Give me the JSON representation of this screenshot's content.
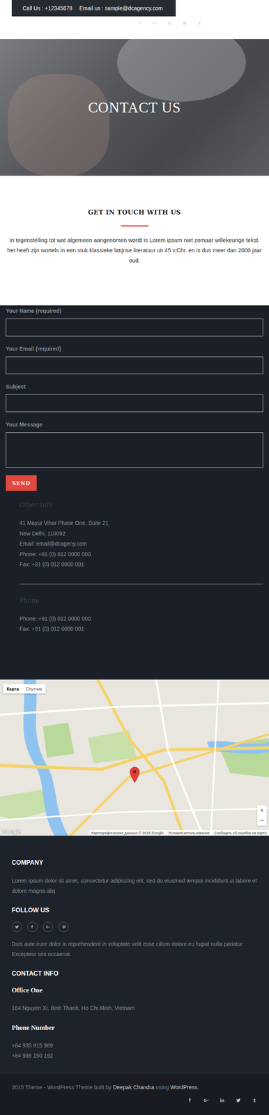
{
  "topbar": {
    "call": "Call Us : +12345678",
    "email": "Email us : sample@dcagency.com"
  },
  "hero": {
    "title": "CONTACT US"
  },
  "intro": {
    "heading": "GET IN TOUCH WITH US",
    "text": "In tegenstelling tot wat algemeen aangenomen wordt is Lorem ipsum niet zomaar willekeurige tekst. het heeft zijn wortels in een stuk klassieke latijnse literatuur uit 45 v.Chr. en is dus meer dan 2000 jaar oud."
  },
  "form": {
    "fields": [
      {
        "label": "Your Name (required)",
        "kind": "input"
      },
      {
        "label": "Your Email (required)",
        "kind": "input"
      },
      {
        "label": "Subject",
        "kind": "input"
      },
      {
        "label": "Your Message",
        "kind": "textarea"
      }
    ],
    "button": "SEND"
  },
  "other_info": {
    "heading": "Other Info",
    "lines": [
      "41 Mayur Vihar Phase One, Suite 21",
      "New Delhi, 110092",
      "Email: email@dcageny.com",
      "Phone: +91 (0) 012 0000 000",
      "Fax: +91 (0) 012 0000 001"
    ]
  },
  "phone": {
    "heading": "Phone",
    "lines": [
      "Phone: +91 (0) 012 0000 000",
      "Fax: +91 (0) 012 0000 001"
    ]
  },
  "map": {
    "tabs": [
      {
        "label": "Карта",
        "selected": true
      },
      {
        "label": "Спутник",
        "selected": false
      }
    ],
    "zoom": [
      "+",
      "−"
    ],
    "logo": "Google",
    "attribution": [
      "Картографические данные © 2016 Google",
      "Условия использования",
      "Сообщить об ошибке на карте"
    ]
  },
  "footer": {
    "company": {
      "heading": "COMPANY",
      "text": "Lorem ipsum dolor sit amet, consectetur adipiscing elit, sed do eiusmod tempor incididunt ut labore et dolore magna aliq"
    },
    "follow": {
      "heading": "FOLLOW US",
      "text": "Duis aute irure dolor in reprehenderit in voluptate velit esse cillum dolore eu fugiat nulla pariatur. Excepteur sint occaecat."
    },
    "contact": {
      "heading": "CONTACT INFO",
      "office_heading": "Office One",
      "address": "164 Nguyen Xi, Binh Thanh, Ho Chi Minh, Vietnam",
      "phone_heading": "Phone Number",
      "phones": [
        "+84 935 815 989",
        "+84 935 150 192"
      ]
    }
  },
  "bottom": {
    "prefix": "2015 Theme - WordPress Theme built by ",
    "author": "Deepak Chandra",
    "mid": " using ",
    "wp": "WordPress."
  }
}
